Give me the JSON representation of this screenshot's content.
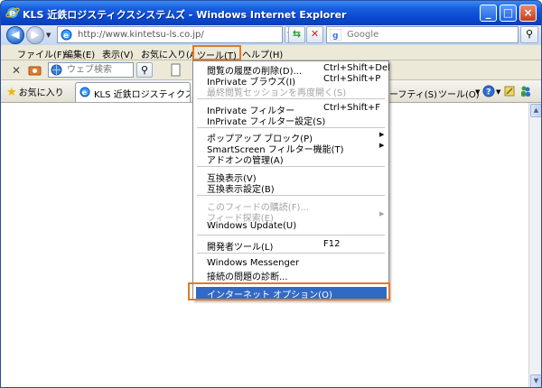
{
  "window": {
    "title": "KLS 近鉄ロジスティクスシステムズ - Windows Internet Explorer",
    "minimize": "_",
    "maximize": "□",
    "close": "×"
  },
  "address": {
    "url": "http://www.kintetsu-ls.co.jp/",
    "search_placeholder": "Google"
  },
  "menubar": {
    "items": [
      "ファイル(F)",
      "編集(E)",
      "表示(V)",
      "お気に入り(A)",
      "ツール(T)",
      "ヘルプ(H)"
    ]
  },
  "toolbar": {
    "web_search_placeholder": "ウェブ検索"
  },
  "favorites": {
    "label": "お気に入り",
    "tab_label": "KLS 近鉄ロジスティクスシス..."
  },
  "commands": {
    "items": [
      "ーフティ(S)",
      "ツール(O)"
    ]
  },
  "tools_menu": {
    "items": [
      {
        "label": "閲覧の履歴の削除(D)...",
        "shortcut": "Ctrl+Shift+Del"
      },
      {
        "label": "InPrivate ブラウズ(I)",
        "shortcut": "Ctrl+Shift+P"
      },
      {
        "label": "最終閲覧セッションを再度開く(S)",
        "shortcut": ""
      },
      {
        "label": "InPrivate フィルター",
        "shortcut": "Ctrl+Shift+F"
      },
      {
        "label": "InPrivate フィルター設定(S)",
        "shortcut": ""
      },
      {
        "label": "ポップアップ ブロック(P)",
        "shortcut": ""
      },
      {
        "label": "SmartScreen フィルター機能(T)",
        "shortcut": ""
      },
      {
        "label": "アドオンの管理(A)",
        "shortcut": ""
      },
      {
        "label": "互換表示(V)",
        "shortcut": ""
      },
      {
        "label": "互換表示設定(B)",
        "shortcut": ""
      },
      {
        "label": "このフィードの購読(F)...",
        "shortcut": ""
      },
      {
        "label": "フィード探索(E)",
        "shortcut": ""
      },
      {
        "label": "Windows Update(U)",
        "shortcut": ""
      },
      {
        "label": "開発者ツール(L)",
        "shortcut": "F12"
      },
      {
        "label": "Windows Messenger",
        "shortcut": ""
      },
      {
        "label": "接続の問題の診断...",
        "shortcut": ""
      },
      {
        "label": "インターネット オプション(O)",
        "shortcut": ""
      }
    ]
  },
  "colors": {
    "highlight": "#316ac5",
    "callout_frame": "#e07a28",
    "titlebar": "#0a49d2"
  }
}
